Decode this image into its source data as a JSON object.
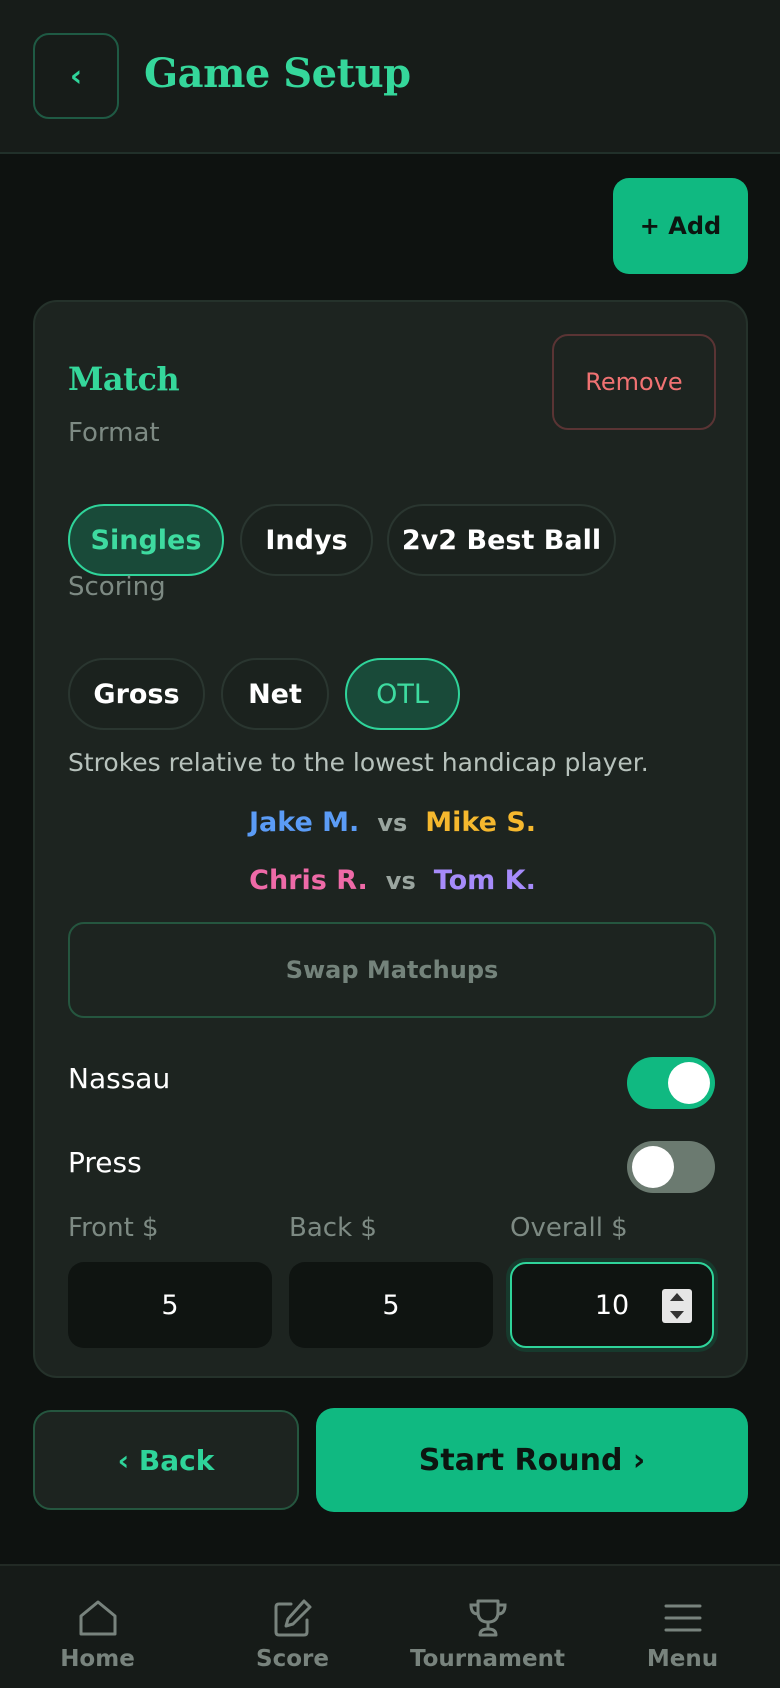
{
  "header": {
    "back_icon": "chevron-left-icon",
    "back_glyph": "‹",
    "title": "Game Setup"
  },
  "add_button": "+ Add",
  "match_card": {
    "title": "Match",
    "remove_label": "Remove",
    "format_label": "Format",
    "format_options": [
      "Singles",
      "Indys",
      "2v2 Best Ball"
    ],
    "format_selected": "Singles",
    "scoring_label": "Scoring",
    "scoring_options": [
      "Gross",
      "Net",
      "OTL"
    ],
    "scoring_selected": "OTL",
    "scoring_description": "Strokes relative to the lowest handicap player.",
    "matchups": [
      {
        "p1": "Jake M.",
        "p1_color": "#5b9cf6",
        "vs": "vs",
        "p2": "Mike S.",
        "p2_color": "#f5b82e"
      },
      {
        "p1": "Chris R.",
        "p1_color": "#ee6aa7",
        "vs": "vs",
        "p2": "Tom K.",
        "p2_color": "#a68bfa"
      }
    ],
    "swap_label": "Swap Matchups",
    "nassau_label": "Nassau",
    "nassau_on": true,
    "press_label": "Press",
    "press_on": false,
    "front_label": "Front $",
    "front_value": "5",
    "back_label": "Back $",
    "back_value": "5",
    "overall_label": "Overall $",
    "overall_value": "10"
  },
  "footer_buttons": {
    "back": "‹ Back",
    "start": "Start Round ›"
  },
  "bottom_nav": [
    {
      "label": "Home",
      "icon": "home-icon"
    },
    {
      "label": "Score",
      "icon": "edit-icon"
    },
    {
      "label": "Tournament",
      "icon": "trophy-icon"
    },
    {
      "label": "Menu",
      "icon": "menu-icon"
    }
  ],
  "colors": {
    "accent": "#10b981",
    "accent_text": "#35d79b",
    "danger": "#f07272",
    "background": "#0e1210",
    "card": "#1d2420"
  }
}
